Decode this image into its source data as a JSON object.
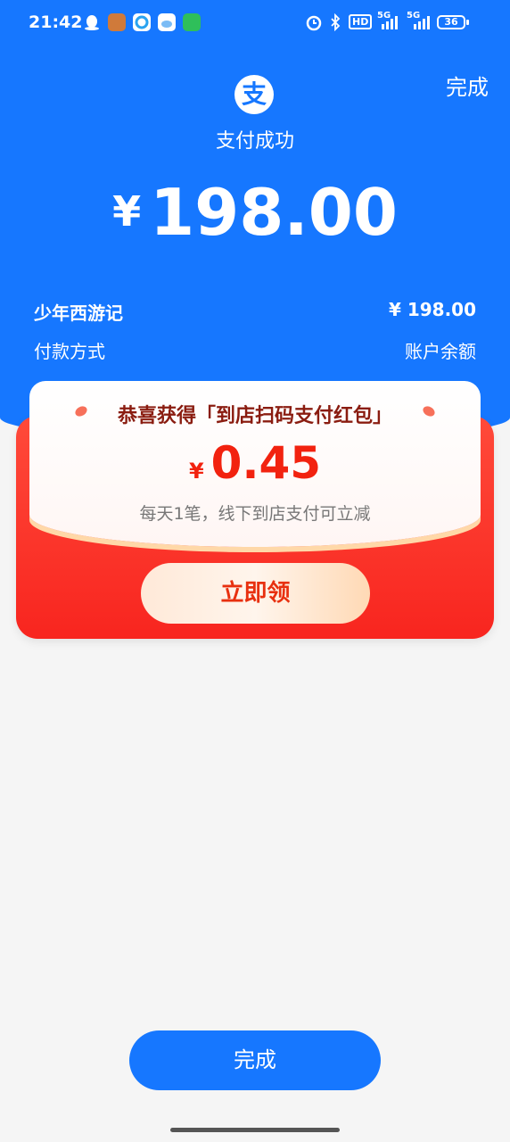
{
  "status_bar": {
    "time": "21:42",
    "network_5g_a": "5G",
    "network_5g_b": "5G",
    "hd": "HD",
    "battery": "36",
    "icons": [
      "qq-icon",
      "game-avatar-icon",
      "browser-icon",
      "weather-icon",
      "message-icon",
      "alarm-icon",
      "bluetooth-icon",
      "hd-icon",
      "signal-icon",
      "battery-icon"
    ]
  },
  "header": {
    "done_label": "完成",
    "logo_glyph": "支",
    "title": "支付成功"
  },
  "payment": {
    "currency_symbol": "¥",
    "amount": "198.00",
    "merchant_label": "少年西游记",
    "merchant_value": "¥ 198.00",
    "method_label": "付款方式",
    "method_value": "账户余额"
  },
  "red_packet": {
    "title": "恭喜获得「到店扫码支付红包」",
    "currency_symbol": "¥",
    "amount": "0.45",
    "description": "每天1笔，线下到店支付可立减",
    "claim_label": "立即领"
  },
  "footer": {
    "done_label": "完成"
  },
  "colors": {
    "primary_blue": "#1677ff",
    "packet_red": "#f8251f",
    "packet_text_red": "#f2220f",
    "background": "#f5f5f5"
  }
}
